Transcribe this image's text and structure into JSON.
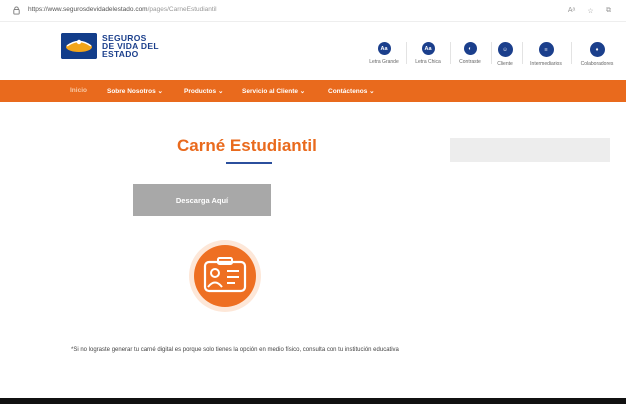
{
  "browser": {
    "url_host": "https://www.segurosdevidadelestado.com",
    "url_path": "/pages/CarneEstudiantil",
    "read_aloud_label": "Aᵃ",
    "favorite_label": "☆",
    "collections_label": "⧉"
  },
  "header": {
    "logo_lines": [
      "SEGUROS",
      "DE VIDA DEL",
      "ESTADO"
    ],
    "tools": [
      {
        "label": "Letra Grande",
        "glyph": "Aa",
        "icon": "text-larger-icon"
      },
      {
        "label": "Letra Chica",
        "glyph": "Aa",
        "icon": "text-smaller-icon"
      },
      {
        "label": "Contraste",
        "glyph": "◐",
        "icon": "contrast-icon"
      },
      {
        "label": "Cliente",
        "glyph": "☺",
        "icon": "client-icon"
      },
      {
        "label": "Intermediarios",
        "glyph": "≡",
        "icon": "intermediaries-icon"
      },
      {
        "label": "Colaboradores",
        "glyph": "♦",
        "icon": "collaborators-icon"
      }
    ]
  },
  "nav": {
    "items": [
      "Inicio",
      "Sobre Nosotros ⌄",
      "Productos ⌄",
      "Servicio al Cliente ⌄",
      "Contáctenos ⌄"
    ]
  },
  "main": {
    "title": "Carné Estudiantil",
    "download_label": "Descarga Aquí",
    "note": "*Si no lograste generar tu carné digital es porque solo tienes la opción en medio físico, consulta con tu institución educativa"
  },
  "colors": {
    "brand_orange": "#e96a1d",
    "brand_blue": "#1b3f8c",
    "button_gray": "#a8a8a8"
  }
}
